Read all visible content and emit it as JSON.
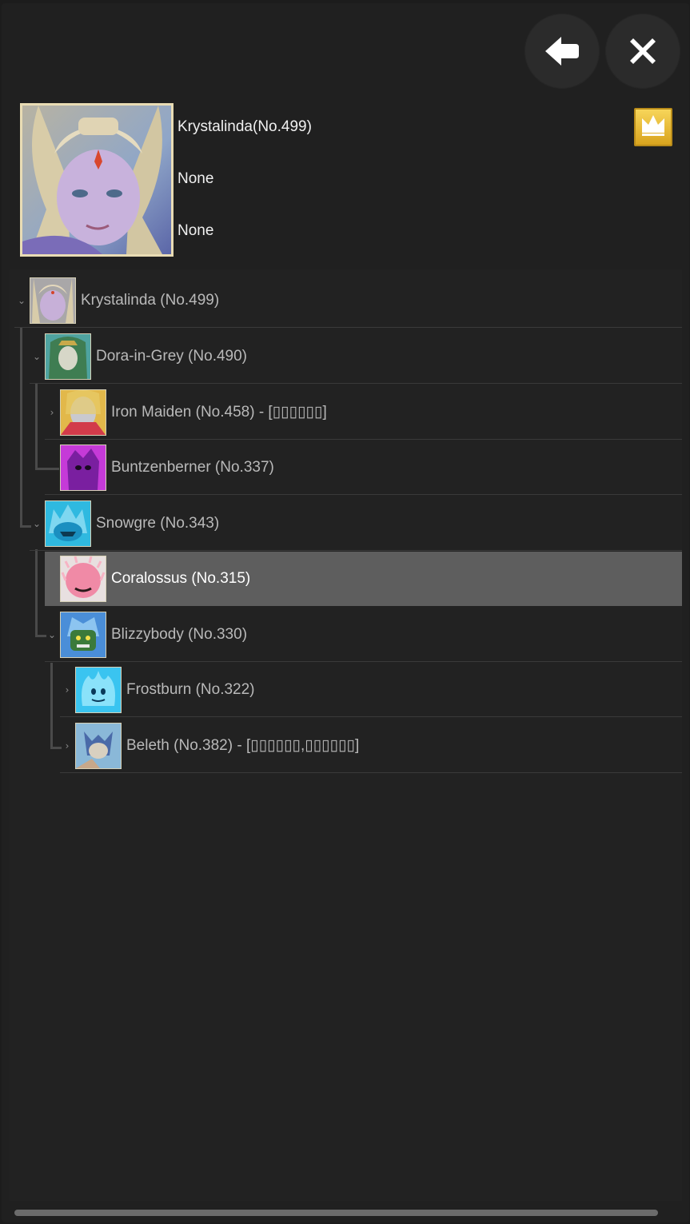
{
  "header": {
    "back_icon": "back-arrow-icon",
    "close_icon": "close-icon",
    "crown_icon": "crown-icon"
  },
  "selected_info": {
    "name": "Krystalinda(No.499)",
    "line2": "None",
    "line3": "None"
  },
  "tree": {
    "nodes": [
      {
        "label": "Krystalinda (No.499)",
        "suffix": "",
        "chevron": "⌄",
        "portrait": "krystalinda"
      },
      {
        "label": "Dora-in-Grey (No.490)",
        "suffix": "",
        "chevron": "⌄",
        "portrait": "dora"
      },
      {
        "label": "Iron Maiden (No.458)",
        "suffix": " - [▯▯▯▯▯▯]",
        "chevron": "›",
        "portrait": "ironmaiden"
      },
      {
        "label": "Buntzenberner (No.337)",
        "suffix": "",
        "chevron": "",
        "portrait": "buntzen"
      },
      {
        "label": "Snowgre (No.343)",
        "suffix": "",
        "chevron": "⌄",
        "portrait": "snowgre"
      },
      {
        "label": "Coralossus (No.315)",
        "suffix": "",
        "chevron": "",
        "portrait": "coralossus"
      },
      {
        "label": "Blizzybody (No.330)",
        "suffix": "",
        "chevron": "⌄",
        "portrait": "blizzy"
      },
      {
        "label": "Frostburn (No.322)",
        "suffix": "",
        "chevron": "›",
        "portrait": "frostburn"
      },
      {
        "label": "Beleth (No.382)",
        "suffix": " - [▯▯▯▯▯▯,▯▯▯▯▯▯]",
        "chevron": "›",
        "portrait": "beleth"
      }
    ]
  }
}
